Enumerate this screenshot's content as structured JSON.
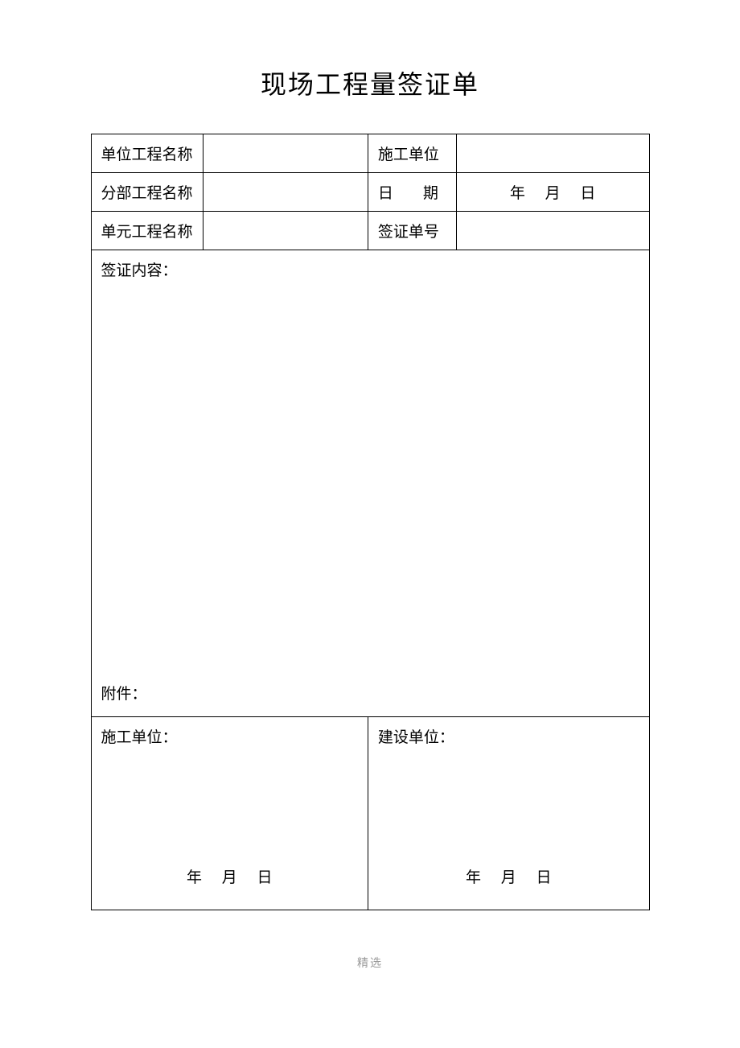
{
  "title": "现场工程量签证单",
  "rows": {
    "unit_project_label": "单位工程名称",
    "unit_project_value": "",
    "construction_unit_label": "施工单位",
    "construction_unit_value": "",
    "sub_project_label": "分部工程名称",
    "sub_project_value": "",
    "date_label_a": "日",
    "date_label_b": "期",
    "date_value_year": "年",
    "date_value_month": "月",
    "date_value_day": "日",
    "element_project_label": "单元工程名称",
    "element_project_value": "",
    "cert_no_label": "签证单号",
    "cert_no_value": ""
  },
  "content": {
    "label": "签证内容：",
    "attachment_label": "附件："
  },
  "sign": {
    "construction_label": "施工单位：",
    "owner_label": "建设单位：",
    "date_year": "年",
    "date_month": "月",
    "date_day": "日"
  },
  "footer": "精选"
}
